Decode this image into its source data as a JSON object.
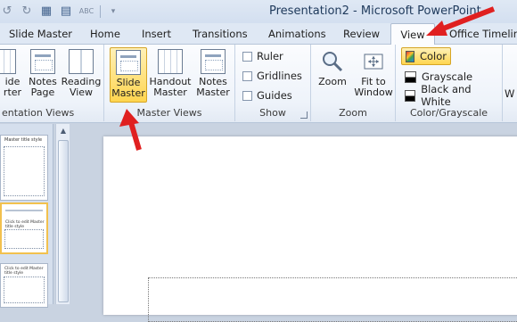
{
  "window": {
    "title": "Presentation2  -  Microsoft PowerPoint"
  },
  "qat": {
    "icons": [
      "undo-icon",
      "redo-icon",
      "save-icon",
      "layout-icon",
      "spelling-icon",
      "customize-icon"
    ],
    "spelling_label": "ABC"
  },
  "tabs": [
    {
      "label": "Slide Master"
    },
    {
      "label": "Home"
    },
    {
      "label": "Insert"
    },
    {
      "label": "Transitions"
    },
    {
      "label": "Animations"
    },
    {
      "label": "Review"
    },
    {
      "label": "View",
      "active": true
    },
    {
      "label": "Office Timeline"
    }
  ],
  "ribbon": {
    "presentation_views": {
      "label": "entation Views",
      "buttons": [
        {
          "label1": "ide",
          "label2": "rter"
        },
        {
          "label1": "Notes",
          "label2": "Page"
        },
        {
          "label1": "Reading",
          "label2": "View"
        }
      ]
    },
    "master_views": {
      "label": "Master Views",
      "buttons": [
        {
          "label1": "Slide",
          "label2": "Master",
          "selected": true
        },
        {
          "label1": "Handout",
          "label2": "Master"
        },
        {
          "label1": "Notes",
          "label2": "Master"
        }
      ]
    },
    "show": {
      "label": "Show",
      "items": [
        {
          "label": "Ruler"
        },
        {
          "label": "Gridlines"
        },
        {
          "label": "Guides"
        }
      ]
    },
    "zoom": {
      "label": "Zoom",
      "buttons": [
        {
          "label1": "Zoom",
          "label2": ""
        },
        {
          "label1": "Fit to",
          "label2": "Window"
        }
      ]
    },
    "color_grayscale": {
      "label": "Color/Grayscale",
      "items": [
        {
          "label": "Color",
          "selected": true
        },
        {
          "label": "Grayscale"
        },
        {
          "label": "Black and White"
        }
      ]
    },
    "next_group_partial": "W"
  },
  "thumbnails": {
    "slide1_title": "Master title style",
    "slide2_title": "Click to edit Master title style",
    "slide3_title": "Click to edit Master title style"
  },
  "colors": {
    "accent_selected": "#ffd54f",
    "arrow_red": "#e02020"
  }
}
